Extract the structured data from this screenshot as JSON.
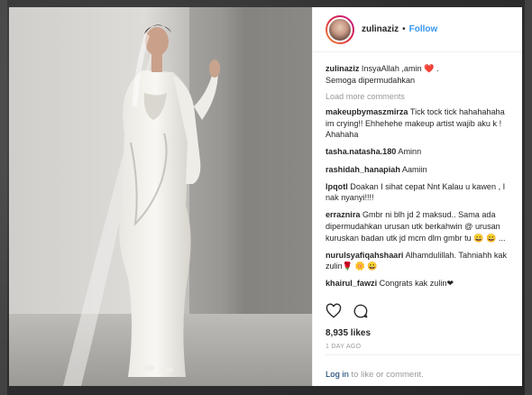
{
  "post": {
    "username": "zulinaziz",
    "separator": "•",
    "follow_label": "Follow",
    "caption_user": "zulinaziz",
    "caption_line1": "InsyaAllah ,amin ❤️ .",
    "caption_line2": "Semoga dipermudahkan",
    "load_more": "Load more comments",
    "likes": "8,935 likes",
    "time_ago": "1 DAY AGO",
    "login_link": "Log in",
    "login_rest": " to like or comment."
  },
  "comments": [
    {
      "user": "makeupbymaszmirza",
      "text": "Tick tock tick hahahahaha im crying!! Ehhehehe makeup artist wajib aku k ! Ahahaha"
    },
    {
      "user": "tasha.natasha.180",
      "text": "Aminn"
    },
    {
      "user": "rashidah_hanapiah",
      "text": "Aamiin"
    },
    {
      "user": "lpqotl",
      "text": "Doakan I sihat cepat Nnt Kalau u kawen , I nak nyanyi!!!!"
    },
    {
      "user": "erraznira",
      "text": "Gmbr ni blh jd 2 maksud.. Sama ada dipermudahkan urusan utk berkahwin @ urusan kuruskan badan utk jd mcm dlm gmbr tu 😀 😀 ..."
    },
    {
      "user": "nurulsyafiqahshaari",
      "text": "Alhamdulillah. Tahniahh kak zulin🌹 🌼 😀"
    },
    {
      "user": "khairul_fawzi",
      "text": "Congrats kak zulin❤"
    }
  ],
  "icons": {
    "like": "heart-outline-icon",
    "comment": "comment-bubble-icon"
  },
  "colors": {
    "link": "#3897f0",
    "login_link": "#003569",
    "muted": "#999999",
    "heart": "#ed4956"
  }
}
